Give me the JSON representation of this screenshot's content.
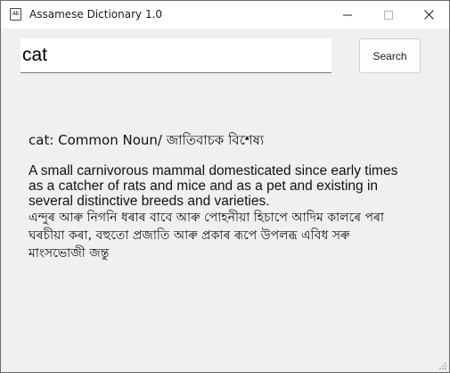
{
  "window": {
    "title": "Assamese Dictionary 1.0",
    "app_icon_glyph": "Ab",
    "icons": {
      "minimize": "minimize-icon",
      "maximize": "maximize-icon",
      "close": "close-icon"
    }
  },
  "search": {
    "value": "cat",
    "button_label": "Search"
  },
  "result": {
    "heading": "cat: Common Noun/ জাতিবাচক বিশেষ্য",
    "definition_en": "A small carnivorous mammal domesticated since early times as a catcher of rats and mice and as a pet and existing in several distinctive breeds and varieties.",
    "definition_as": "এন্দুৰ আৰু নিগনি ধৰাৰ বাবে আৰু পোহনীয়া হিচাপে আদিম কালৰে পৰা ঘৰচীয়া কৰা, বহুতো প্ৰজাতি আৰু প্ৰকাৰ ৰূপে উপলব্ধ এবিধ সৰু মাংসভোজী জন্তু"
  },
  "colors": {
    "window_bg": "#f0f0f0",
    "titlebar_bg": "#ffffff",
    "text": "#111111"
  }
}
